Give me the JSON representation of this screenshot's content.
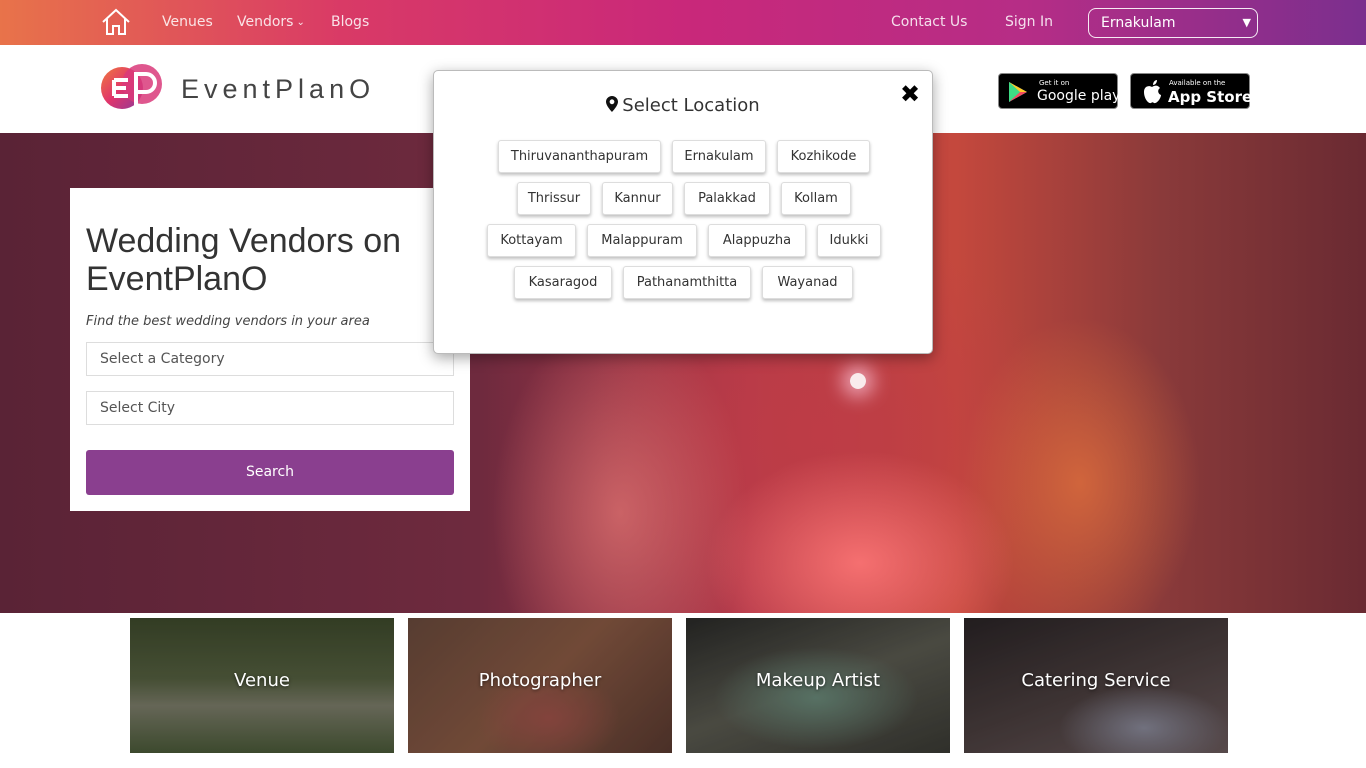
{
  "nav": {
    "home_icon": "home-icon",
    "venues": "Venues",
    "vendors": "Vendors",
    "blogs": "Blogs",
    "contact": "Contact Us",
    "signin": "Sign In",
    "city_selected": "Ernakulam",
    "color_accent_start": "#e8734a",
    "color_accent_end": "#7b2f8e"
  },
  "header": {
    "logo_text": "EventPlanO",
    "google_small": "Get it on",
    "google_big": "Google play",
    "apple_small": "Available on the",
    "apple_big": "App Store"
  },
  "search_card": {
    "title": "Wedding Vendors on EventPlanO",
    "subtitle": "Find the best wedding vendors in your area",
    "category_placeholder": "Select a Category",
    "city_placeholder": "Select City",
    "search_label": "Search",
    "button_color": "#8a3f8f"
  },
  "tiles": [
    {
      "label": "Venue"
    },
    {
      "label": "Photographer"
    },
    {
      "label": "Makeup Artist"
    },
    {
      "label": "Catering Service"
    }
  ],
  "modal": {
    "title": "Select Location",
    "close_icon": "close-icon",
    "locations": [
      "Thiruvananthapuram",
      "Ernakulam",
      "Kozhikode",
      "Thrissur",
      "Kannur",
      "Palakkad",
      "Kollam",
      "Kottayam",
      "Malappuram",
      "Alappuzha",
      "Idukki",
      "Kasaragod",
      "Pathanamthitta",
      "Wayanad"
    ]
  }
}
